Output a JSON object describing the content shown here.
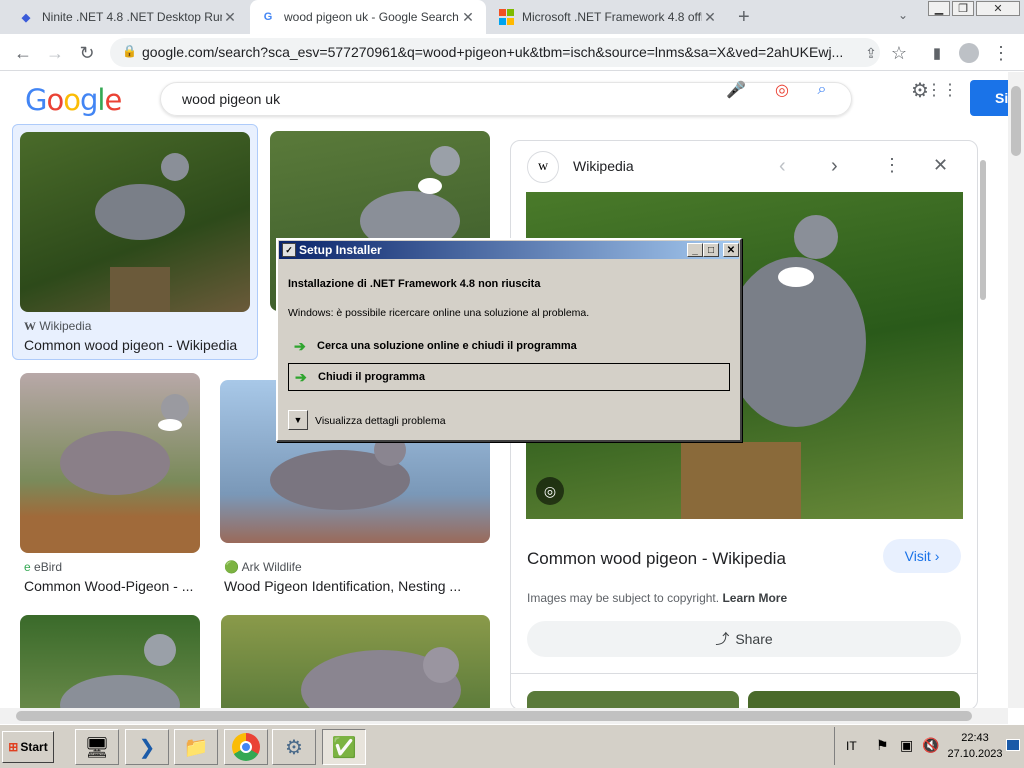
{
  "tabs": [
    {
      "title": "Ninite .NET 4.8 .NET Desktop Runti",
      "close": "✕"
    },
    {
      "title": "wood pigeon uk - Google Search",
      "close": "✕"
    },
    {
      "title": "Microsoft .NET Framework 4.8 offli",
      "close": "✕"
    }
  ],
  "new_tab": "+",
  "address": {
    "url": "google.com/search?sca_esv=577270961&q=wood+pigeon+uk&tbm=isch&source=lnms&sa=X&ved=2ahUKEwj..."
  },
  "search": {
    "query": "wood pigeon uk",
    "logo": "Google",
    "signin": "Si"
  },
  "results": [
    {
      "source": "Wikipedia",
      "source_icon": "W",
      "title": "Common wood pigeon - Wikipedia"
    },
    {
      "source": "eBird",
      "source_icon": "e",
      "title": "Common Wood-Pigeon - ..."
    },
    {
      "source": "Ark Wildlife",
      "source_icon": "🟢",
      "title": "Wood Pigeon Identification, Nesting ..."
    }
  ],
  "panel": {
    "source": "Wikipedia",
    "title": "Common wood pigeon - Wikipedia",
    "visit": "Visit ›",
    "copyright": "Images may be subject to copyright.",
    "learn_more": "Learn More",
    "share": "Share"
  },
  "dialog": {
    "title": "Setup Installer",
    "heading": "Installazione di .NET Framework 4.8 non riuscita",
    "message": "Windows: è possibile ricercare online una soluzione al problema.",
    "option1": "Cerca una soluzione online e chiudi il programma",
    "option2": "Chiudi il programma",
    "details": "Visualizza dettagli problema"
  },
  "taskbar": {
    "start": "Start",
    "lang": "IT",
    "time": "22:43",
    "date": "27.10.2023"
  },
  "colors": {
    "google_blue": "#4285f4",
    "google_red": "#ea4335",
    "google_yellow": "#fbbc05",
    "google_green": "#34a853"
  }
}
